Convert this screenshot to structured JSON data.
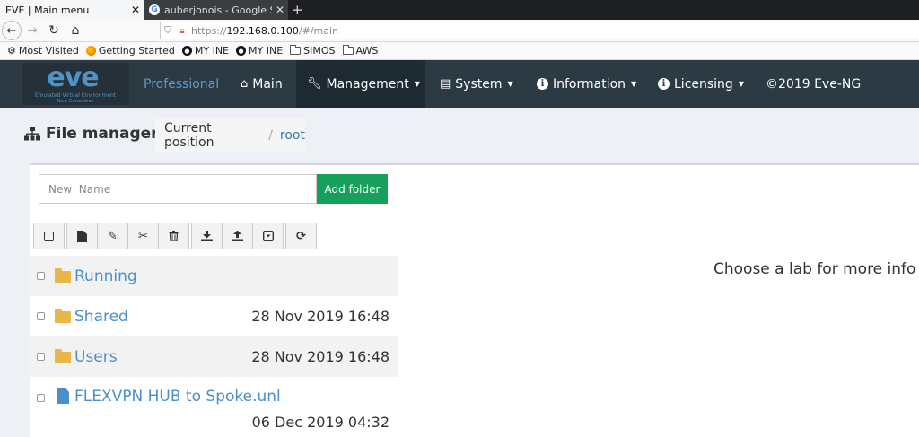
{
  "browser": {
    "tabs": [
      {
        "title": "EVE | Main menu",
        "active": true
      },
      {
        "title": "auberjonois - Google Sea",
        "active": false
      }
    ],
    "new_tab": "+",
    "close": "✕",
    "url": {
      "prefix": "https://",
      "host": "192.168.0.100",
      "path": "/#/main"
    },
    "bookmarks": [
      {
        "icon": "gear-icon",
        "label": "Most Visited"
      },
      {
        "icon": "firefox-icon",
        "label": "Getting Started"
      },
      {
        "icon": "ine-icon",
        "label": "MY INE"
      },
      {
        "icon": "ine-icon",
        "label": "MY INE"
      },
      {
        "icon": "folder-icon",
        "label": "SIMOS"
      },
      {
        "icon": "folder-icon",
        "label": "AWS"
      }
    ]
  },
  "app": {
    "logo": "eve",
    "logo_sub": "Emulated Virtual Environment",
    "logo_sub2": "Next Generation",
    "menu": {
      "brand": "Professional",
      "main": "Main",
      "management": "Management",
      "system": "System",
      "information": "Information",
      "licensing": "Licensing",
      "copyright": "©2019 Eve-NG"
    },
    "accent": "#2b3a43"
  },
  "page": {
    "title": "File manager",
    "breadcrumb_label": "Current position",
    "breadcrumb_sep": "/",
    "breadcrumb_root": "root"
  },
  "form": {
    "placeholder": "New  Name",
    "add_folder": "Add folder",
    "add_color": "#16a05c"
  },
  "files": [
    {
      "type": "folder",
      "name": "Running",
      "date": ""
    },
    {
      "type": "folder",
      "name": "Shared",
      "date": "28 Nov 2019 16:48"
    },
    {
      "type": "folder",
      "name": "Users",
      "date": "28 Nov 2019 16:48"
    },
    {
      "type": "file",
      "name": "FLEXVPN HUB to Spoke.unl",
      "date": "06 Dec 2019 04:32"
    }
  ],
  "info": "Choose a lab for more info"
}
